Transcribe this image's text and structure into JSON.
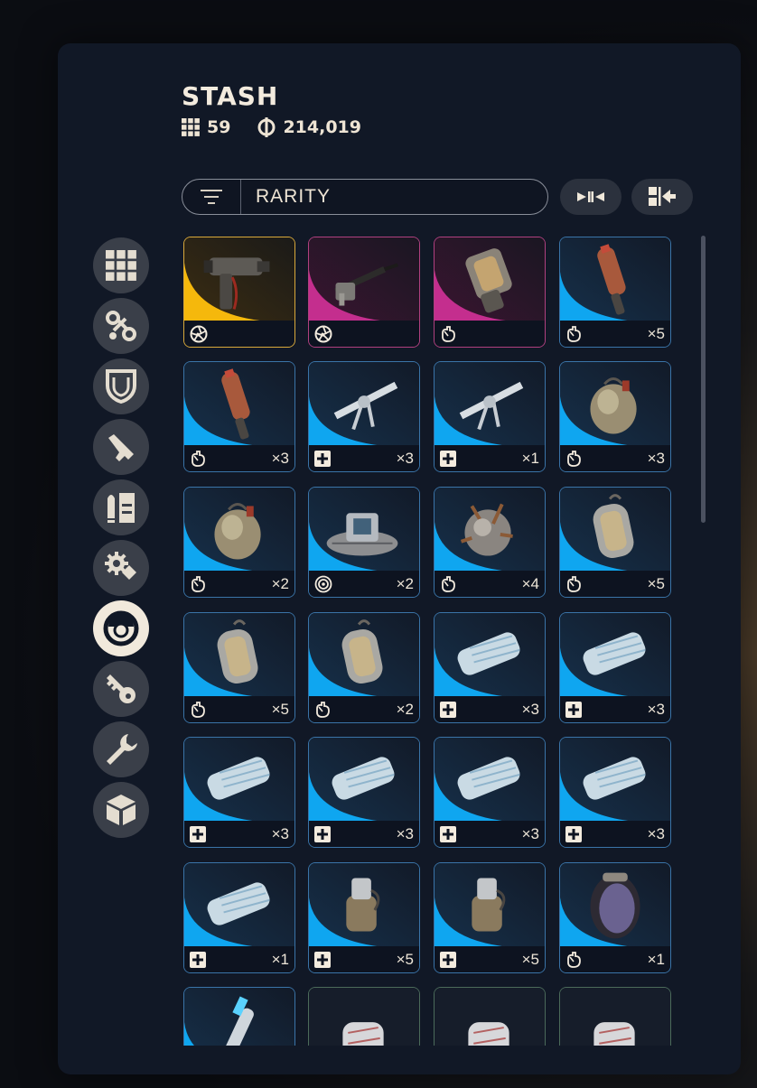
{
  "header": {
    "title": "STASH",
    "slot_count": "59",
    "currency": "214,019"
  },
  "filter": {
    "label": "RARITY"
  },
  "sidebar": {
    "items": [
      {
        "name": "all-items",
        "icon": "grid-icon",
        "active": false
      },
      {
        "name": "augments",
        "icon": "augment-icon",
        "active": false
      },
      {
        "name": "shields",
        "icon": "shield-icon",
        "active": false
      },
      {
        "name": "weapons",
        "icon": "pistol-icon",
        "active": false
      },
      {
        "name": "ammo",
        "icon": "ammo-icon",
        "active": false
      },
      {
        "name": "mods",
        "icon": "gear-mod-icon",
        "active": false
      },
      {
        "name": "quick-use",
        "icon": "quick-use-icon",
        "active": true
      },
      {
        "name": "keys",
        "icon": "key-icon",
        "active": false
      },
      {
        "name": "materials",
        "icon": "wrench-icon",
        "active": false
      },
      {
        "name": "misc",
        "icon": "cube-icon",
        "active": false
      }
    ]
  },
  "colors": {
    "legendary": "#f5b80c",
    "epic": "#c42e8e",
    "uncommon": "#0fa6f0",
    "common": "#4b6a5a"
  },
  "items": [
    {
      "name": "tool",
      "rarity": "legendary",
      "icon": "aperture-icon",
      "qty": ""
    },
    {
      "name": "grappling-hook",
      "rarity": "epic",
      "icon": "aperture-icon",
      "qty": ""
    },
    {
      "name": "canister-device",
      "rarity": "epic",
      "icon": "hand-icon",
      "qty": ""
    },
    {
      "name": "flare",
      "rarity": "uncommon",
      "icon": "hand-icon",
      "qty": "×5"
    },
    {
      "name": "flare",
      "rarity": "uncommon",
      "icon": "hand-icon",
      "qty": "×3"
    },
    {
      "name": "injector",
      "rarity": "uncommon",
      "icon": "plus-icon",
      "qty": "×3"
    },
    {
      "name": "injector",
      "rarity": "uncommon",
      "icon": "plus-icon",
      "qty": "×1"
    },
    {
      "name": "grenade",
      "rarity": "uncommon",
      "icon": "hand-icon",
      "qty": "×3"
    },
    {
      "name": "grenade",
      "rarity": "uncommon",
      "icon": "hand-icon",
      "qty": "×2"
    },
    {
      "name": "mine",
      "rarity": "uncommon",
      "icon": "target-icon",
      "qty": "×2"
    },
    {
      "name": "spiked-grenade",
      "rarity": "uncommon",
      "icon": "hand-icon",
      "qty": "×4"
    },
    {
      "name": "canister-grenade",
      "rarity": "uncommon",
      "icon": "hand-icon",
      "qty": "×5"
    },
    {
      "name": "canister-grenade",
      "rarity": "uncommon",
      "icon": "hand-icon",
      "qty": "×5"
    },
    {
      "name": "canister-grenade",
      "rarity": "uncommon",
      "icon": "hand-icon",
      "qty": "×2"
    },
    {
      "name": "bandage",
      "rarity": "uncommon",
      "icon": "plus-icon",
      "qty": "×3"
    },
    {
      "name": "bandage",
      "rarity": "uncommon",
      "icon": "plus-icon",
      "qty": "×3"
    },
    {
      "name": "bandage",
      "rarity": "uncommon",
      "icon": "plus-icon",
      "qty": "×3"
    },
    {
      "name": "bandage",
      "rarity": "uncommon",
      "icon": "plus-icon",
      "qty": "×3"
    },
    {
      "name": "bandage",
      "rarity": "uncommon",
      "icon": "plus-icon",
      "qty": "×3"
    },
    {
      "name": "bandage",
      "rarity": "uncommon",
      "icon": "plus-icon",
      "qty": "×3"
    },
    {
      "name": "bandage",
      "rarity": "uncommon",
      "icon": "plus-icon",
      "qty": "×1"
    },
    {
      "name": "stim-canister",
      "rarity": "uncommon",
      "icon": "plus-icon",
      "qty": "×5"
    },
    {
      "name": "stim-canister",
      "rarity": "uncommon",
      "icon": "plus-icon",
      "qty": "×5"
    },
    {
      "name": "smoke-pod",
      "rarity": "uncommon",
      "icon": "hand-icon",
      "qty": "×1"
    },
    {
      "name": "syringe",
      "rarity": "uncommon",
      "icon": "",
      "qty": ""
    },
    {
      "name": "wrap",
      "rarity": "common",
      "icon": "",
      "qty": ""
    },
    {
      "name": "wrap",
      "rarity": "common",
      "icon": "",
      "qty": ""
    },
    {
      "name": "wrap",
      "rarity": "common",
      "icon": "",
      "qty": ""
    }
  ]
}
